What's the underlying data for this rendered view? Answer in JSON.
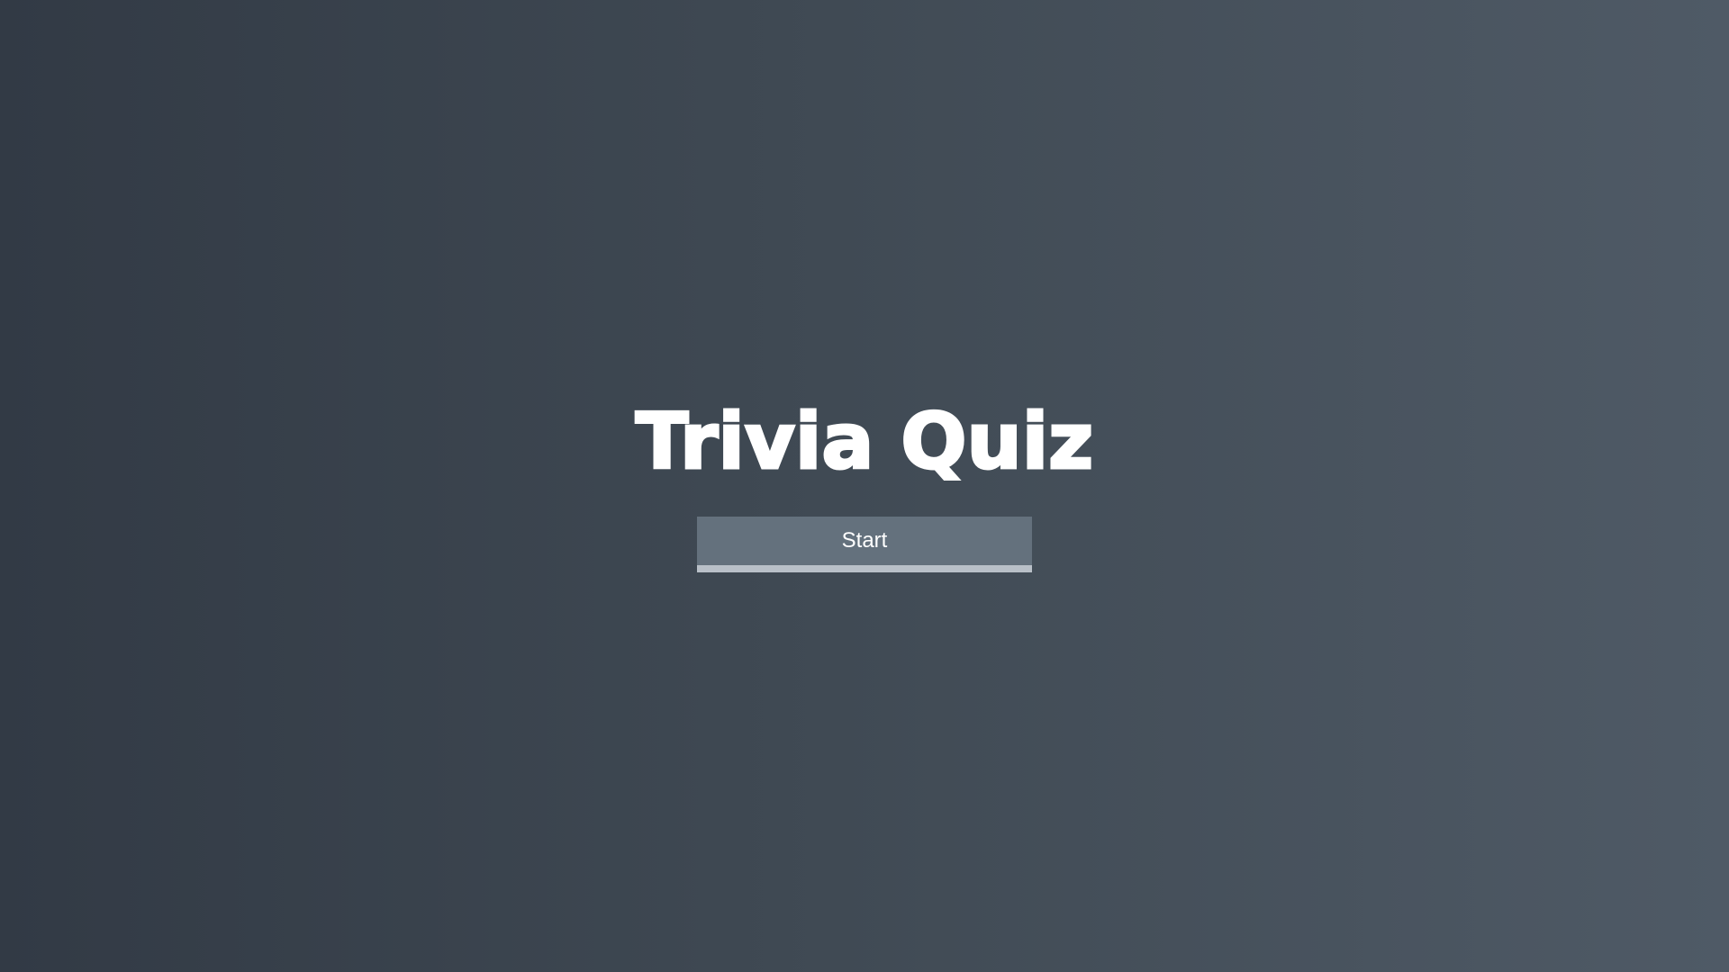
{
  "app": {
    "title": "Trivia Quiz"
  },
  "actions": {
    "start_label": "Start"
  },
  "colors": {
    "background_start": "#323a45",
    "background_end": "#4f5a66",
    "button_fill": "#64717d",
    "button_bottom_bar": "#b9c0c8",
    "text": "#ffffff"
  }
}
